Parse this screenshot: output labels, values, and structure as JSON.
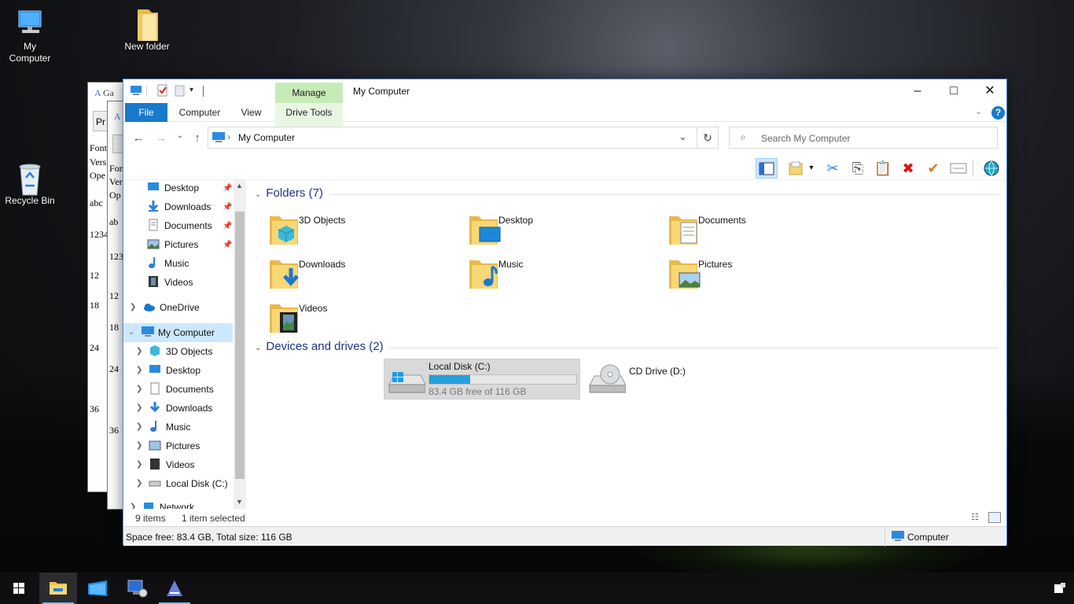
{
  "desktop": {
    "icons": [
      {
        "label": "My\nComputer"
      },
      {
        "label": "New folder"
      },
      {
        "label": "Recycle Bin"
      }
    ]
  },
  "background_window": {
    "title_fragment": "Ga",
    "button_fragment": "Pr",
    "lines_a": [
      "Font",
      "Vers",
      "Ope",
      "abc",
      "1234",
      "12",
      "18",
      "24",
      "36"
    ],
    "lines_b": [
      "Fon",
      "Ver",
      "Op",
      "ab",
      "123",
      "12",
      "18",
      "24",
      "36"
    ]
  },
  "window": {
    "title": "My Computer",
    "manage_tab": "Manage",
    "tabs": {
      "file": "File",
      "computer": "Computer",
      "view": "View",
      "drive_tools": "Drive Tools"
    },
    "address": "My Computer",
    "search_placeholder": "Search My Computer"
  },
  "nav": {
    "quick_access": [
      "Desktop",
      "Downloads",
      "Documents",
      "Pictures",
      "Music",
      "Videos"
    ],
    "onedrive": "OneDrive",
    "this_pc": "My Computer",
    "this_pc_children": [
      "3D Objects",
      "Desktop",
      "Documents",
      "Downloads",
      "Music",
      "Pictures",
      "Videos",
      "Local Disk (C:)"
    ],
    "network": "Network"
  },
  "content": {
    "folders_header": "Folders (7)",
    "folders": [
      "3D Objects",
      "Desktop",
      "Documents",
      "Downloads",
      "Music",
      "Pictures",
      "Videos"
    ],
    "drives_header": "Devices and drives (2)",
    "drives": [
      {
        "name": "Local Disk (C:)",
        "free_text": "83.4 GB free of 116 GB",
        "used_fraction": 0.28
      },
      {
        "name": "CD Drive (D:)"
      }
    ]
  },
  "status": {
    "items": "9 items",
    "selected": "1 item selected"
  },
  "footer": {
    "space": "Space free: 83.4 GB, Total size: 116 GB",
    "location": "Computer"
  },
  "colors": {
    "accent": "#1979ca",
    "manage": "#c6ebb6",
    "folder": "#f8d775",
    "drive_bar": "#26a0da"
  }
}
